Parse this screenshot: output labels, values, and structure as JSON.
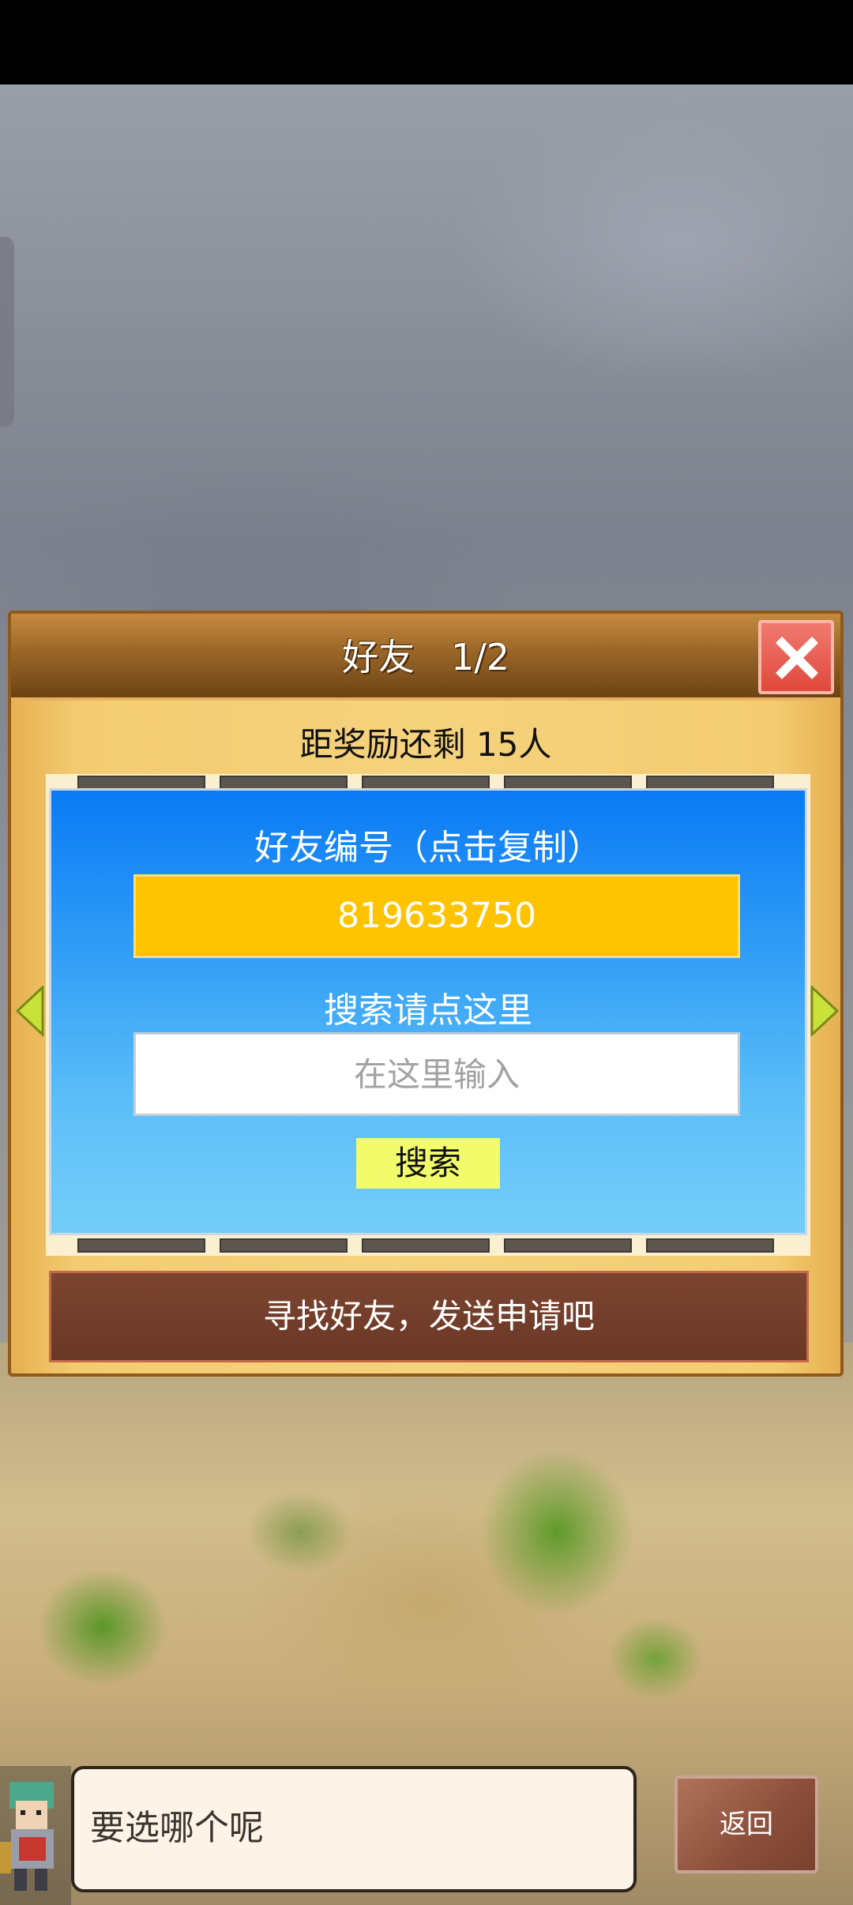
{
  "dialog": {
    "title": "好友　1/2",
    "reward_text": "距奖励还剩 15人",
    "friend_id_label": "好友编号（点击复制）",
    "friend_id": "819633750",
    "search_label": "搜索请点这里",
    "search_placeholder": "在这里输入",
    "search_button": "搜索",
    "footer_text": "寻找好友，发送申请吧"
  },
  "message": {
    "text": "要选哪个呢"
  },
  "back_button": "返回",
  "icons": {
    "close": "close-icon",
    "prev": "arrow-left-icon",
    "next": "arrow-right-icon",
    "avatar": "character-avatar"
  },
  "colors": {
    "header_brown": "#6d4314",
    "panel_blue": "#0a7af5",
    "friend_id_yellow": "#ffc300",
    "search_button_yellow": "#f2fb6a",
    "close_red": "#e0483c"
  }
}
